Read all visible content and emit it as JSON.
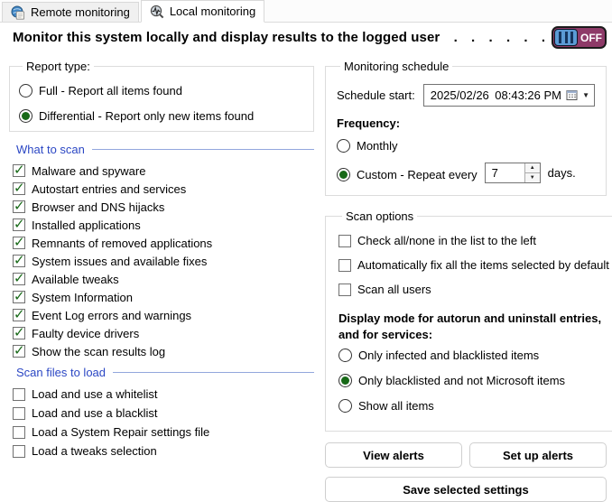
{
  "tabs": [
    {
      "label": "Remote monitoring",
      "icon": "globe-page-icon",
      "active": false
    },
    {
      "label": "Local monitoring",
      "icon": "magnifier-pulse-icon",
      "active": true
    }
  ],
  "header": {
    "title": "Monitor this system locally and display results to the logged user  .  .  .  .  .  .",
    "toggle_state": "OFF"
  },
  "report_type": {
    "legend": "Report type:",
    "options": [
      {
        "label": "Full - Report all items found",
        "selected": false
      },
      {
        "label": "Differential - Report only new items found",
        "selected": true
      }
    ]
  },
  "what_to_scan": {
    "heading": "What to scan",
    "items": [
      {
        "label": "Malware and spyware",
        "checked": true
      },
      {
        "label": "Autostart entries and services",
        "checked": true
      },
      {
        "label": "Browser and DNS hijacks",
        "checked": true
      },
      {
        "label": "Installed applications",
        "checked": true
      },
      {
        "label": "Remnants of removed applications",
        "checked": true
      },
      {
        "label": "System issues and available fixes",
        "checked": true
      },
      {
        "label": "Available tweaks",
        "checked": true
      },
      {
        "label": "System Information",
        "checked": true
      },
      {
        "label": "Event Log errors and warnings",
        "checked": true
      },
      {
        "label": "Faulty device drivers",
        "checked": true
      },
      {
        "label": "Show the scan results log",
        "checked": true
      }
    ]
  },
  "scan_files": {
    "heading": "Scan files to load",
    "items": [
      {
        "label": "Load and use a whitelist",
        "checked": false
      },
      {
        "label": "Load and use a blacklist",
        "checked": false
      },
      {
        "label": "Load a System Repair settings file",
        "checked": false
      },
      {
        "label": "Load a tweaks selection",
        "checked": false
      }
    ]
  },
  "monitoring_schedule": {
    "legend": "Monitoring schedule",
    "schedule_start_label": "Schedule start:",
    "schedule_start_value": "2025/02/26 08:43:26 PM",
    "frequency_label": "Frequency:",
    "options": [
      {
        "label": "Monthly",
        "selected": false
      },
      {
        "label": "Custom - Repeat every",
        "selected": true,
        "value": "7",
        "suffix": "days."
      }
    ]
  },
  "scan_options": {
    "legend": "Scan options",
    "checkboxes": [
      {
        "label": "Check all/none in the list to the left",
        "checked": false
      },
      {
        "label": "Automatically fix all the items selected by default",
        "checked": false
      },
      {
        "label": "Scan all users",
        "checked": false
      }
    ],
    "display_mode_label": "Display mode for autorun and uninstall entries, and for services:",
    "display_modes": [
      {
        "label": "Only infected and blacklisted items",
        "selected": false
      },
      {
        "label": "Only blacklisted and not Microsoft items",
        "selected": true
      },
      {
        "label": "Show all items",
        "selected": false
      }
    ]
  },
  "buttons": {
    "view_alerts": "View alerts",
    "set_up_alerts": "Set up alerts",
    "save_settings": "Save selected settings"
  },
  "colors": {
    "section_heading_blue": "#2b47c4",
    "check_green": "#176917",
    "toggle_off_bg": "#8e3a68",
    "toggle_handle_blue": "#5b9bd5"
  }
}
